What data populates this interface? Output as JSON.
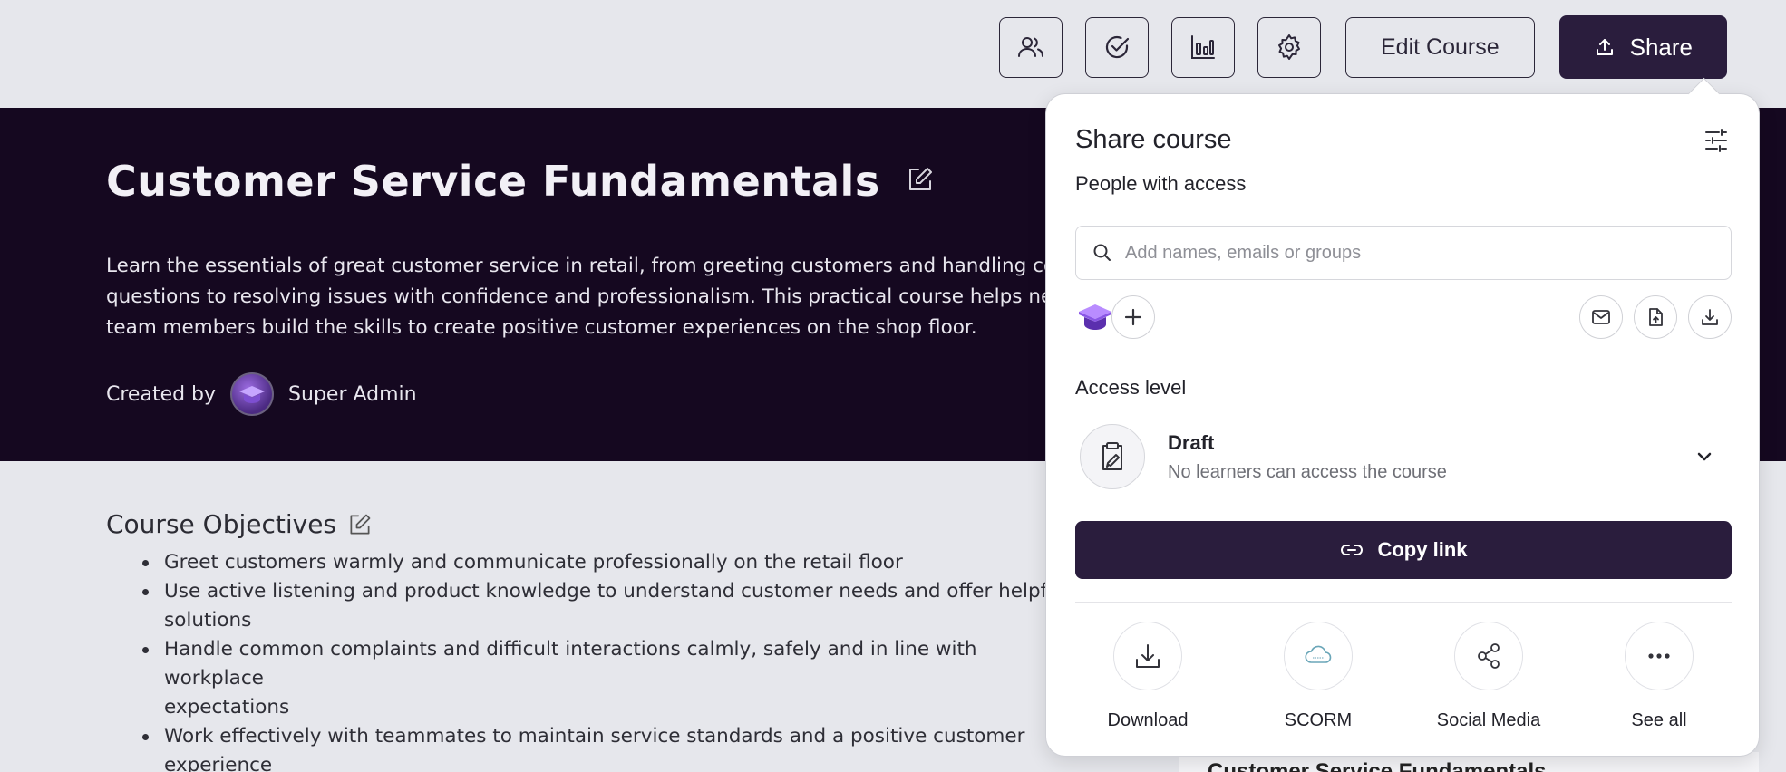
{
  "toolbar": {
    "icons": [
      "people-icon",
      "check-circle-icon",
      "bar-chart-icon",
      "gear-icon"
    ],
    "edit_course_label": "Edit Course",
    "share_label": "Share"
  },
  "hero": {
    "title": "Customer Service Fundamentals",
    "description_lines": [
      "Learn the essentials of great customer service in retail, from greeting customers and handling common",
      "questions to resolving issues with confidence and professionalism. This practical course helps new retail",
      "team members build the skills to create positive customer experiences on the shop floor."
    ],
    "created_by_label": "Created by",
    "author": "Super Admin"
  },
  "objectives": {
    "heading": "Course Objectives",
    "items": [
      "Greet customers warmly and communicate professionally on the retail floor",
      "Use active listening and product knowledge to understand customer needs and offer helpful",
      "solutions",
      "Handle common complaints and difficult interactions calmly, safely and in line with workplace",
      "expectations",
      "Work effectively with teammates to maintain service standards and a positive customer",
      "experience"
    ]
  },
  "bottom_card": {
    "title": "Customer Service Fundamentals"
  },
  "share_panel": {
    "title": "Share course",
    "people_label": "People with access",
    "search_placeholder": "Add names, emails or groups",
    "access_label": "Access level",
    "access_title": "Draft",
    "access_subtitle": "No learners can access the course",
    "copy_link_label": "Copy link",
    "options": [
      {
        "label": "Download",
        "icon": "download-icon"
      },
      {
        "label": "SCORM",
        "icon": "scorm-cloud-icon"
      },
      {
        "label": "Social Media",
        "icon": "share-nodes-icon"
      },
      {
        "label": "See all",
        "icon": "more-dots-icon"
      }
    ]
  },
  "colors": {
    "page_bg": "#e6e7ec",
    "hero_bg": "#150820",
    "accent_dark": "#2a1d3d"
  }
}
